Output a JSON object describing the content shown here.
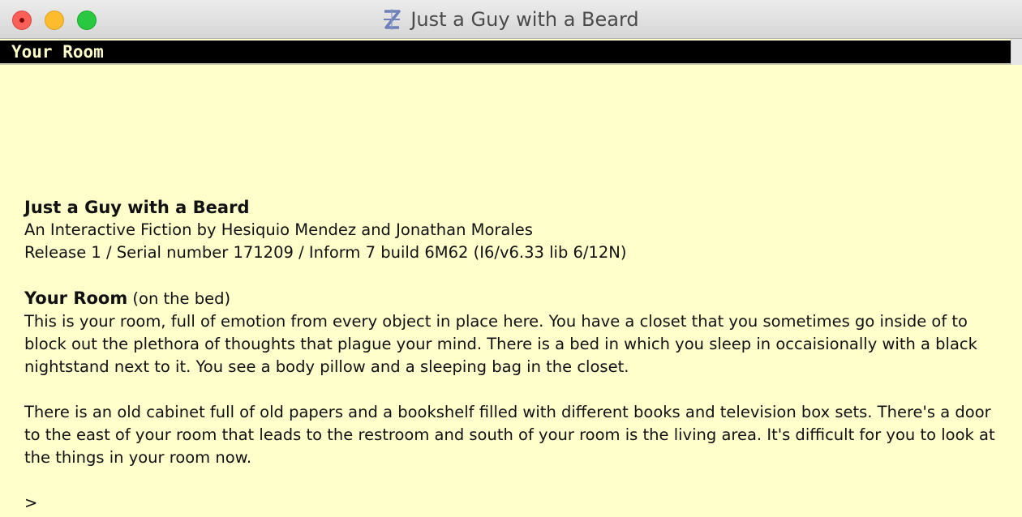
{
  "window": {
    "title": "Just a Guy with a Beard"
  },
  "icons": {
    "app": "z-interpreter-icon",
    "close": "close-icon",
    "minimize": "minimize-icon",
    "zoom": "zoom-icon"
  },
  "colors": {
    "background": "#ffffcc",
    "status_bar": "#000000",
    "status_text": "#ffffcc"
  },
  "status_bar": {
    "location": "Your Room"
  },
  "story": {
    "game_title": "Just a Guy with a Beard",
    "byline": "An Interactive Fiction by Hesiquio Mendez and Jonathan Morales",
    "release_line": "Release 1 / Serial number 171209 / Inform 7 build 6M62 (I6/v6.33 lib 6/12N)",
    "room_name": "Your Room",
    "room_position": " (on the bed)",
    "paragraph1": "This is your room, full of emotion from every object in place here. You have a closet that you sometimes go inside of to block out the plethora of thoughts that plague your mind. There is a bed in which you sleep in occaisionally with a black nightstand next to it. You see a body pillow and a sleeping bag in the closet.",
    "paragraph2": "There is an old cabinet full of old papers and a bookshelf filled with different books and television box sets. There's a door to the east of your room that leads to the restroom and south of your room is the living area. It's difficult for you to look at the things in your room now.",
    "prompt": ">",
    "input_value": ""
  }
}
